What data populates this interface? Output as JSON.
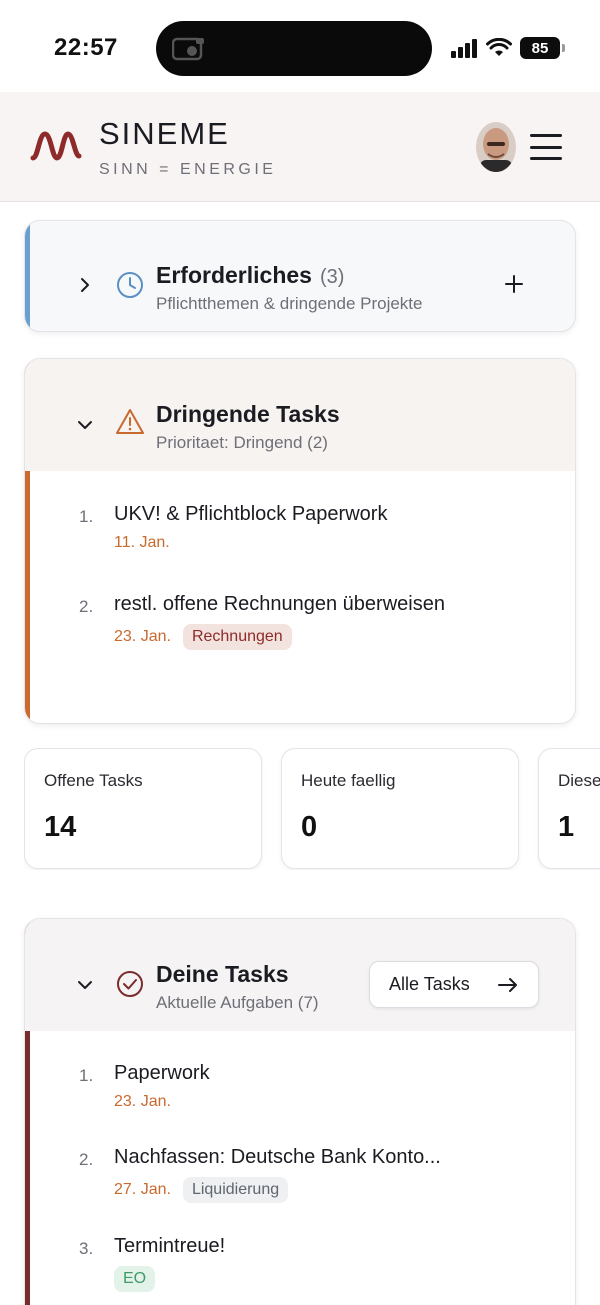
{
  "status_bar": {
    "time": "22:57",
    "battery": "85"
  },
  "header": {
    "brand": "SINEME",
    "tagline": "SINN = ENERGIE"
  },
  "required": {
    "title": "Erforderliches",
    "count": "(3)",
    "subtitle": "Pflichtthemen & dringende Projekte",
    "accent": "#6c9fd0"
  },
  "urgent": {
    "title": "Dringende Tasks",
    "subtitle": "Prioritaet: Dringend (2)",
    "accent": "#c96a2e",
    "tasks": [
      {
        "num": "1.",
        "title": "UKV! & Pflichtblock Paperwork",
        "date": "11. Jan.",
        "tag": ""
      },
      {
        "num": "2.",
        "title": "restl. offene Rechnungen überweisen",
        "date": "23. Jan.",
        "tag": "Rechnungen"
      }
    ]
  },
  "stats": [
    {
      "label": "Offene Tasks",
      "value": "14"
    },
    {
      "label": "Heute faellig",
      "value": "0"
    },
    {
      "label": "Diese",
      "value": "1"
    }
  ],
  "my_tasks": {
    "title": "Deine Tasks",
    "subtitle": "Aktuelle Aufgaben (7)",
    "button": "Alle Tasks",
    "accent": "#7a2b2b",
    "tasks": [
      {
        "num": "1.",
        "title": "Paperwork",
        "date": "23. Jan.",
        "tag": ""
      },
      {
        "num": "2.",
        "title": "Nachfassen: Deutsche Bank Konto...",
        "date": "27. Jan.",
        "tag": "Liquidierung"
      },
      {
        "num": "3.",
        "title": "Termintreue!",
        "date": "",
        "tag": "EO"
      }
    ]
  }
}
